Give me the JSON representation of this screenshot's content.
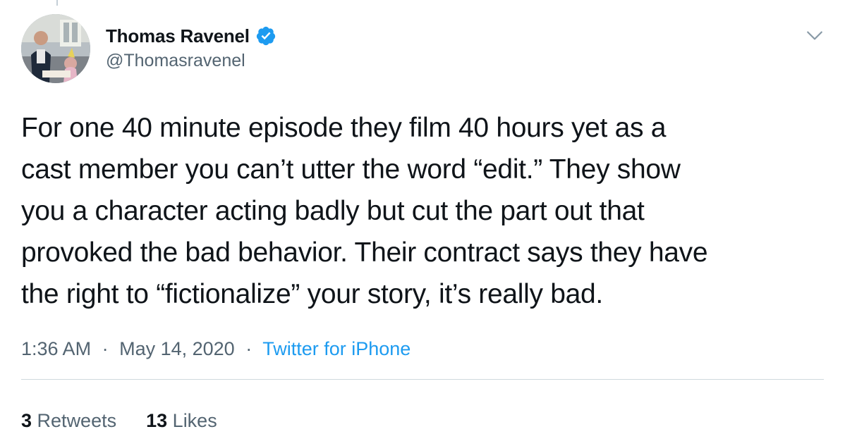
{
  "author": {
    "display_name": "Thomas Ravenel",
    "handle": "@Thomasravenel",
    "verified": true,
    "avatar_icon": "profile-photo"
  },
  "tweet": {
    "text_lines": [
      "For one 40 minute episode they film 40 hours yet as a",
      "cast member you can’t utter the word “edit.” They show",
      "you a character acting badly but cut the part out that",
      "provoked the bad behavior. Their contract says they have",
      "the right to “fictionalize” your story, it’s really bad."
    ]
  },
  "meta": {
    "time": "1:36 AM",
    "separator": "·",
    "date": "May 14, 2020",
    "source": "Twitter for iPhone"
  },
  "stats": {
    "retweets_count": "3",
    "retweets_label": "Retweets",
    "likes_count": "13",
    "likes_label": "Likes"
  },
  "colors": {
    "verified_badge": "#1d9bf0",
    "link": "#1d9bf0",
    "secondary_text": "#536471"
  },
  "icons": {
    "menu": "chevron-down-icon",
    "verified": "verified-badge-icon"
  }
}
